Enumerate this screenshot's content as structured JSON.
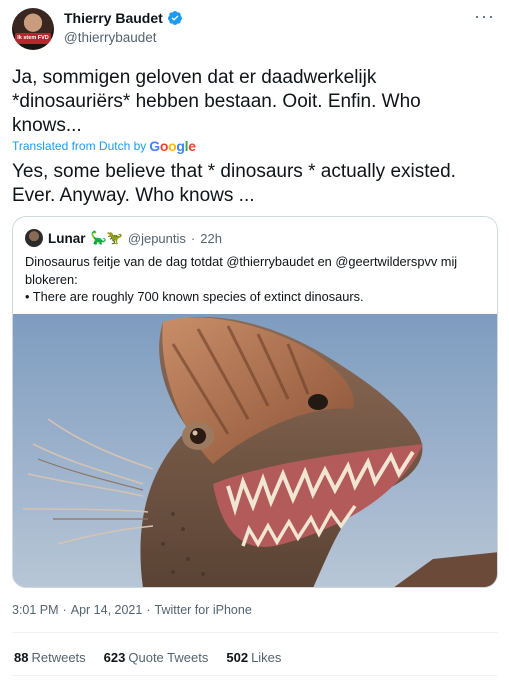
{
  "author": {
    "name": "Thierry Baudet",
    "handle": "@thierrybaudet",
    "avatar_badge": "Ik stem FVD"
  },
  "tweet": {
    "text_original": "Ja, sommigen geloven dat er daadwerkelijk *dinosauriërs* hebben bestaan. Ooit. Enfin. Who knows...",
    "translated_label": "Translated from Dutch by",
    "translator": "Google",
    "text_translated": "Yes, some believe that * dinosaurs * actually existed. Ever. Anyway. Who knows ..."
  },
  "quote": {
    "name": "Lunar",
    "emoji": "🦕🦖",
    "handle": "@jepuntis",
    "separator": "·",
    "time": "22h",
    "text_line1": "Dinosaurus feitje van de dag totdat @thierrybaudet en @geertwilderspvv mij blokeren:",
    "text_line2": "• There are roughly 700 known species of extinct dinosaurs.",
    "image_alt": "dilophosaurus-image"
  },
  "meta": {
    "time": "3:01 PM",
    "sep1": "·",
    "date": "Apr 14, 2021",
    "sep2": "·",
    "client": "Twitter for iPhone"
  },
  "stats": {
    "retweets_count": "88",
    "retweets_label": "Retweets",
    "quotes_count": "623",
    "quotes_label": "Quote Tweets",
    "likes_count": "502",
    "likes_label": "Likes"
  },
  "colors": {
    "link_blue": "#1d9bf0",
    "secondary_text": "#536471",
    "border": "#cfd9de"
  }
}
